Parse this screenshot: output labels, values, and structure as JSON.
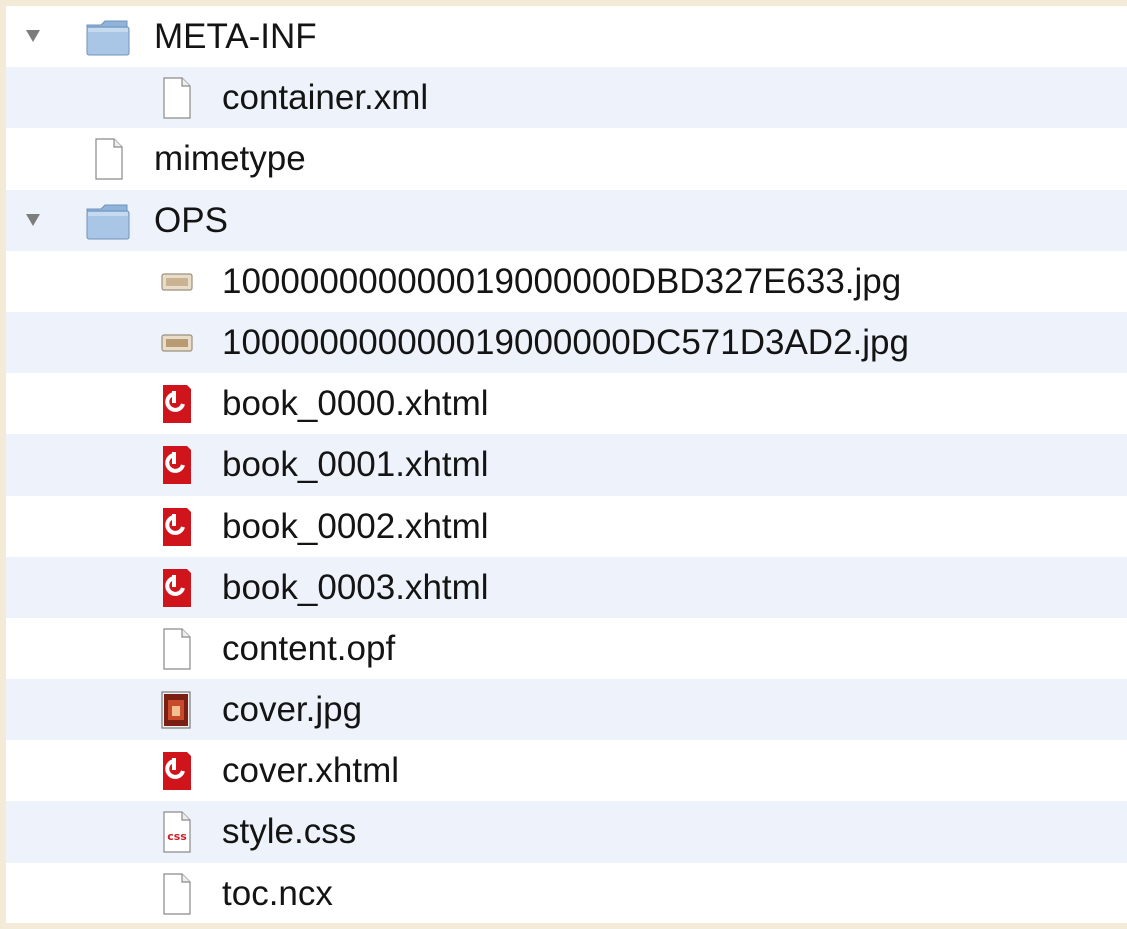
{
  "file_list": {
    "rows": [
      {
        "name": "META-INF",
        "icon": "folder-icon",
        "kind": "folder",
        "expanded": true
      },
      {
        "name": "container.xml",
        "icon": "document-icon",
        "kind": "file"
      },
      {
        "name": "mimetype",
        "icon": "document-icon",
        "kind": "file"
      },
      {
        "name": "OPS",
        "icon": "folder-icon",
        "kind": "folder",
        "expanded": true
      },
      {
        "name": "100000000000019000000DBD327E633.jpg",
        "icon": "image-thumbnail-icon",
        "kind": "file"
      },
      {
        "name": "100000000000019000000DC571D3AD2.jpg",
        "icon": "image-thumbnail-icon",
        "kind": "file"
      },
      {
        "name": "book_0000.xhtml",
        "icon": "xhtml-document-icon",
        "kind": "file"
      },
      {
        "name": "book_0001.xhtml",
        "icon": "xhtml-document-icon",
        "kind": "file"
      },
      {
        "name": "book_0002.xhtml",
        "icon": "xhtml-document-icon",
        "kind": "file"
      },
      {
        "name": "book_0003.xhtml",
        "icon": "xhtml-document-icon",
        "kind": "file"
      },
      {
        "name": "content.opf",
        "icon": "document-icon",
        "kind": "file"
      },
      {
        "name": "cover.jpg",
        "icon": "image-preview-icon",
        "kind": "file"
      },
      {
        "name": "cover.xhtml",
        "icon": "xhtml-document-icon",
        "kind": "file"
      },
      {
        "name": "style.css",
        "icon": "css-document-icon",
        "kind": "file",
        "icon_text": "css"
      },
      {
        "name": "toc.ncx",
        "icon": "document-icon",
        "kind": "file"
      }
    ]
  },
  "colors": {
    "background": "#f3ead7",
    "row_alt": "#eef3fb",
    "folder": "#a9c6e6",
    "xhtml_icon": "#d0141c",
    "disclosure": "#7d7d7d"
  }
}
